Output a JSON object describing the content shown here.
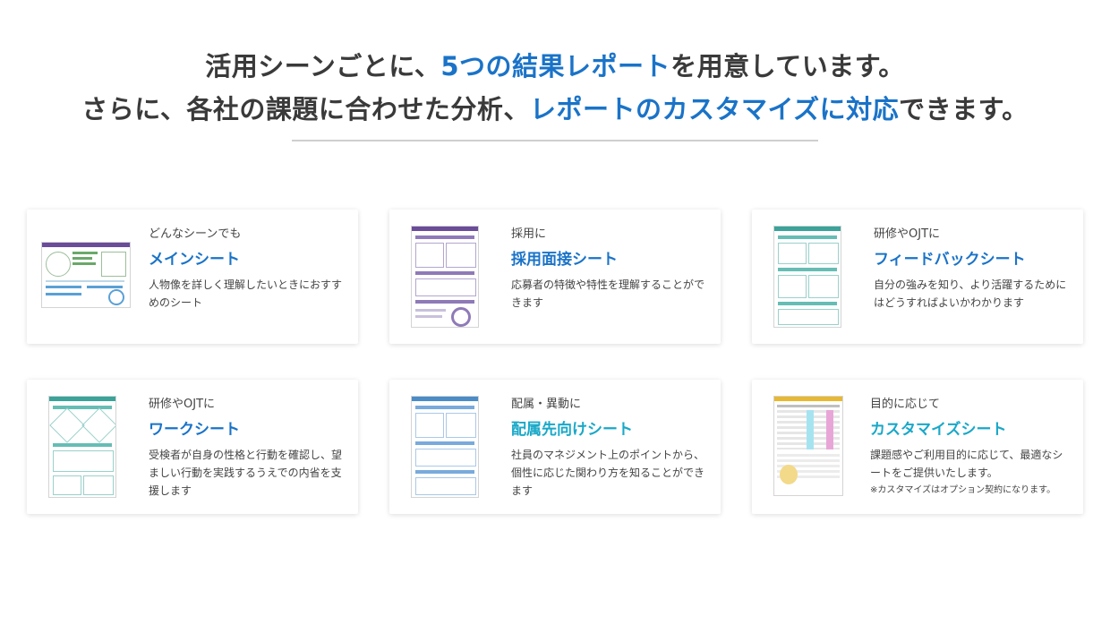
{
  "headline": {
    "line1_pre": "活用シーンごとに、",
    "line1_hl": "5つの結果レポート",
    "line1_post": "を用意しています。",
    "line2_pre": "さらに、各社の課題に合わせた分析、",
    "line2_hl": "レポートのカスタマイズに対応",
    "line2_post": "できます。"
  },
  "colors": {
    "accent": "#1a73c8",
    "accent_cyan": "#19a8c8",
    "purple": "#6b4c9a",
    "teal": "#3aa39a",
    "blue": "#4a8cc8"
  },
  "cards": [
    {
      "lead": "どんなシーンでも",
      "title": "メインシート",
      "desc": "人物像を詳しく理解したいときにおすすめのシート",
      "thumb_icon": "main-sheet-thumbnail"
    },
    {
      "lead": "採用に",
      "title": "採用面接シート",
      "desc": "応募者の特徴や特性を理解することができます",
      "thumb_icon": "interview-sheet-thumbnail"
    },
    {
      "lead": "研修やOJTに",
      "title": "フィードバックシート",
      "desc": "自分の強みを知り、より活躍するためにはどうすればよいかわかります",
      "thumb_icon": "feedback-sheet-thumbnail"
    },
    {
      "lead": "研修やOJTに",
      "title": "ワークシート",
      "desc": "受検者が自身の性格と行動を確認し、望ましい行動を実践するうえでの内省を支援します",
      "thumb_icon": "work-sheet-thumbnail"
    },
    {
      "lead": "配属・異動に",
      "title": "配属先向けシート",
      "desc": "社員のマネジメント上のポイントから、個性に応じた関わり方を知ることができます",
      "thumb_icon": "placement-sheet-thumbnail"
    },
    {
      "lead": "目的に応じて",
      "title": "カスタマイズシート",
      "desc": "課題感やご利用目的に応じて、最適なシートをご提供いたします。",
      "note": "※カスタマイズはオプション契約になります。",
      "thumb_icon": "custom-sheet-thumbnail"
    }
  ]
}
